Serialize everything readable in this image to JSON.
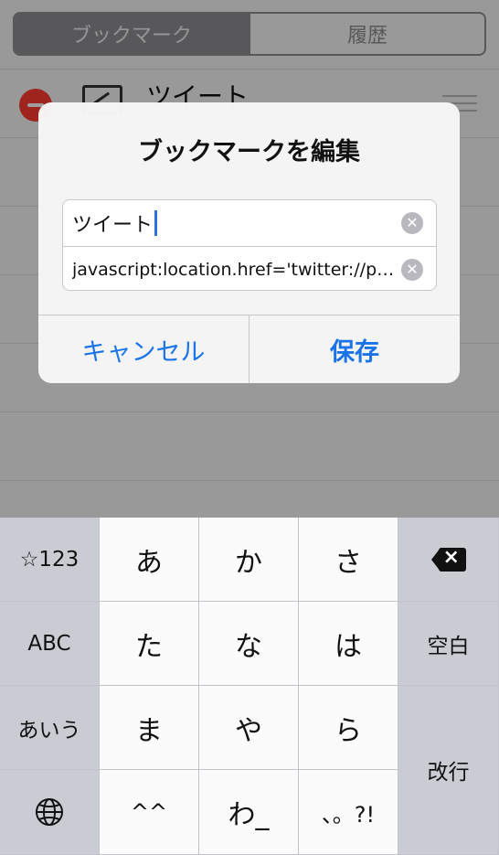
{
  "segments": [
    {
      "label": "ブックマーク",
      "active": true
    },
    {
      "label": "履歴",
      "active": false
    }
  ],
  "bookmarks": [
    {
      "title": "ツイート"
    }
  ],
  "alert": {
    "title": "ブックマークを編集",
    "title_value": "ツイート",
    "url_value": "javascript:location.href='twitter://po…",
    "cancel_label": "キャンセル",
    "save_label": "保存",
    "clear_symbol": "✕"
  },
  "keyboard": {
    "numbers_label": "☆123",
    "abc_label": "ABC",
    "kana_label": "あいう",
    "keys": [
      "あ",
      "か",
      "さ",
      "た",
      "な",
      "は",
      "ま",
      "や",
      "ら",
      "^^",
      "わ_",
      "、。?!"
    ],
    "space_label": "空白",
    "return_label": "改行",
    "icons": [
      "backspace-icon",
      "globe-icon"
    ]
  },
  "colors": {
    "accent": "#1a73e8",
    "delete": "#ff3b30",
    "caret": "#2f6fd8"
  }
}
